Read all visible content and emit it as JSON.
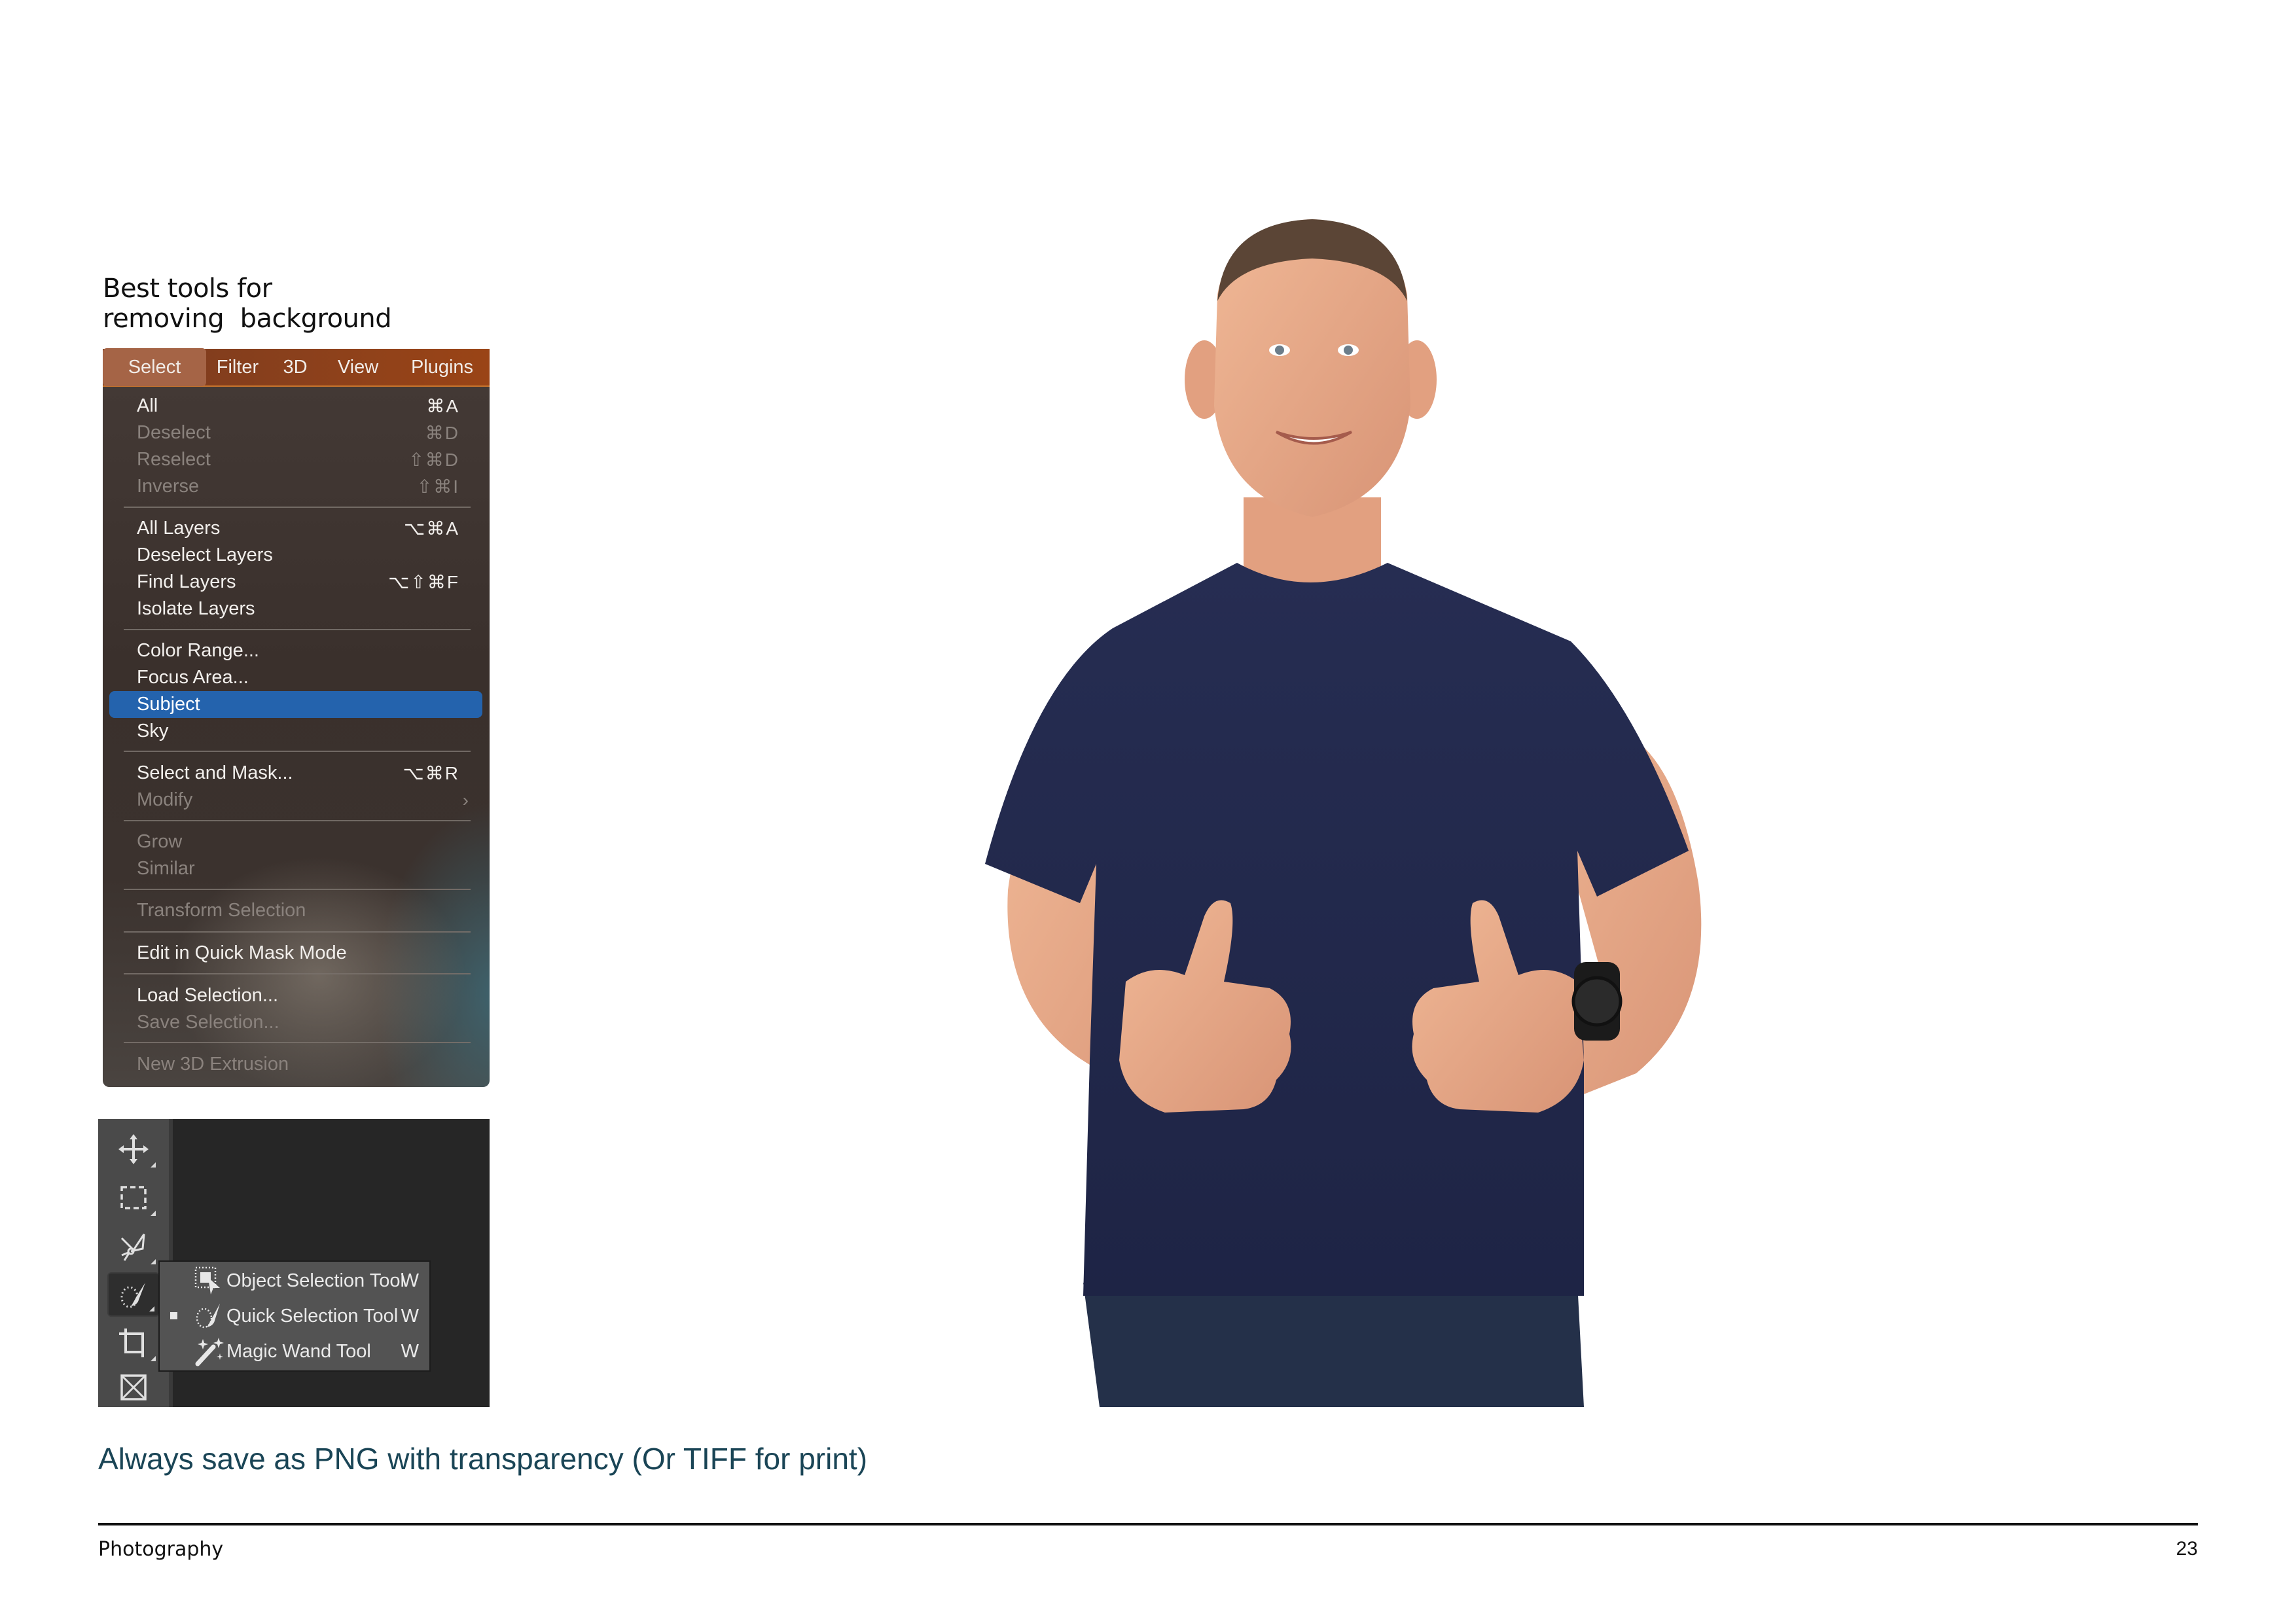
{
  "heading": {
    "line1": "Best tools for",
    "line2": "removing  background"
  },
  "menubar": {
    "items": [
      {
        "label": "Select",
        "active": true
      },
      {
        "label": "Filter"
      },
      {
        "label": "3D"
      },
      {
        "label": "View"
      },
      {
        "label": "Plugins"
      }
    ]
  },
  "select_menu": {
    "items": [
      {
        "label": "All",
        "shortcut": "⌘A",
        "enabled": true
      },
      {
        "label": "Deselect",
        "shortcut": "⌘D",
        "enabled": false
      },
      {
        "label": "Reselect",
        "shortcut": "⇧⌘D",
        "enabled": false
      },
      {
        "label": "Inverse",
        "shortcut": "⇧⌘I",
        "enabled": false
      },
      {
        "label": "All Layers",
        "shortcut": "⌥⌘A",
        "enabled": true
      },
      {
        "label": "Deselect Layers",
        "shortcut": "",
        "enabled": true
      },
      {
        "label": "Find Layers",
        "shortcut": "⌥⇧⌘F",
        "enabled": true
      },
      {
        "label": "Isolate Layers",
        "shortcut": "",
        "enabled": true
      },
      {
        "label": "Color Range...",
        "shortcut": "",
        "enabled": true
      },
      {
        "label": "Focus Area...",
        "shortcut": "",
        "enabled": true
      },
      {
        "label": "Subject",
        "shortcut": "",
        "enabled": true,
        "highlighted": true
      },
      {
        "label": "Sky",
        "shortcut": "",
        "enabled": true
      },
      {
        "label": "Select and Mask...",
        "shortcut": "⌥⌘R",
        "enabled": true
      },
      {
        "label": "Modify",
        "shortcut": "›",
        "enabled": false
      },
      {
        "label": "Grow",
        "shortcut": "",
        "enabled": false
      },
      {
        "label": "Similar",
        "shortcut": "",
        "enabled": false
      },
      {
        "label": "Transform Selection",
        "shortcut": "",
        "enabled": false
      },
      {
        "label": "Edit in Quick Mask Mode",
        "shortcut": "",
        "enabled": true
      },
      {
        "label": "Load Selection...",
        "shortcut": "",
        "enabled": true
      },
      {
        "label": "Save Selection...",
        "shortcut": "",
        "enabled": false
      },
      {
        "label": "New 3D Extrusion",
        "shortcut": "",
        "enabled": false
      }
    ]
  },
  "toolbar": {
    "tools": [
      {
        "name": "move-tool",
        "icon": "move-icon"
      },
      {
        "name": "rectangular-marquee-tool",
        "icon": "marquee-icon"
      },
      {
        "name": "polygonal-lasso-tool",
        "icon": "lasso-icon"
      },
      {
        "name": "quick-selection-tool",
        "icon": "quick-selection-icon",
        "active": true
      },
      {
        "name": "crop-tool",
        "icon": "crop-icon"
      },
      {
        "name": "frame-tool",
        "icon": "frame-icon"
      }
    ],
    "flyout": [
      {
        "label": "Object Selection Tool",
        "key": "W",
        "icon": "object-selection-icon",
        "current": false
      },
      {
        "label": "Quick Selection Tool",
        "key": "W",
        "icon": "quick-selection-icon",
        "current": true
      },
      {
        "label": "Magic Wand Tool",
        "key": "W",
        "icon": "magic-wand-icon",
        "current": false
      }
    ]
  },
  "photo": {
    "subject": "man in navy t-shirt giving two thumbs up, background removed"
  },
  "caption": "Always save as PNG with transparency (Or TIFF for print)",
  "footer": {
    "section": "Photography",
    "page_number": "23"
  },
  "colors": {
    "caption": "#1a4556",
    "menubar": "#8a401c",
    "highlight": "#2463ad",
    "shirt": "#222a4d"
  }
}
